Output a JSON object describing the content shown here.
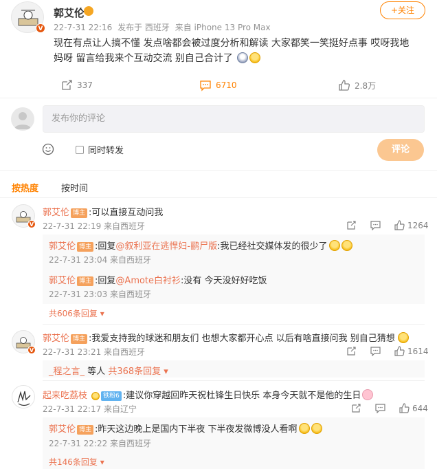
{
  "post": {
    "author": "郭艾伦",
    "date": "22-7-31 22:16",
    "posted_from": "发布于 西班牙",
    "device": "来自 iPhone 13 Pro Max",
    "follow_label": "+关注",
    "body": "现在有点让人搞不懂 发点啥都会被过度分析和解读 大家都笑一笑挺好点事 哎呀我地妈呀 留言给我来个互动交流 别自己合计了",
    "emoji_icons": [
      "sad-face-icon",
      "laughing-face-icon"
    ],
    "repost_count": "337",
    "comment_count": "6710",
    "like_count": "2.8万"
  },
  "compose": {
    "placeholder": "发布你的评论",
    "repost_label": "同时转发",
    "submit_label": "评论"
  },
  "sort": {
    "hot_label": "按热度",
    "time_label": "按时间"
  },
  "comments": [
    {
      "user": "郭艾伦",
      "badge": "博主",
      "text": ":可以直接互动问我",
      "meta": "22-7-31 22:19 来自西班牙",
      "likes": "1264",
      "replies": [
        {
          "user": "郭艾伦",
          "badge": "博主",
          "prefix": ":回复",
          "mention": "@叙利亚在逃悍妇-鹂尸版",
          "text": ":我已经社交媒体发的很少了",
          "meta": "22-7-31 23:04 来自西班牙"
        },
        {
          "user": "郭艾伦",
          "badge": "博主",
          "prefix": ":回复",
          "mention": "@Amote白衬衫",
          "text": ":没有 今天没好好吃饭",
          "meta": "22-7-31 23:03 来自西班牙"
        }
      ],
      "more": "共606条回复"
    },
    {
      "user": "郭艾伦",
      "badge": "博主",
      "text": ":我爱支持我的球迷和朋友们 也想大家都开心点 以后有啥直接问我 别自己猜想",
      "meta": "22-7-31 23:21 来自西班牙",
      "likes": "1614",
      "reply_summary_user": "_程之言_",
      "reply_summary_text": "等人",
      "more": "共368条回复"
    },
    {
      "user": "起来吃荔枝",
      "badge": "铁粉6",
      "text": ":建议你穿越回昨天祝杜锋生日快乐 本身今天就不是他的生日",
      "meta": "22-7-31 22:17 来自辽宁",
      "likes": "644",
      "replies": [
        {
          "user": "郭艾伦",
          "badge": "博主",
          "text": ":昨天这边晚上是国内下半夜 下半夜发微博没人看啊",
          "meta": "22-7-31 22:22 来自西班牙"
        }
      ],
      "more": "共146条回复"
    }
  ],
  "colors": {
    "accent": "#ff8200",
    "username": "#eb7350",
    "meta": "#939393",
    "submit_disabled": "#fbc791"
  }
}
